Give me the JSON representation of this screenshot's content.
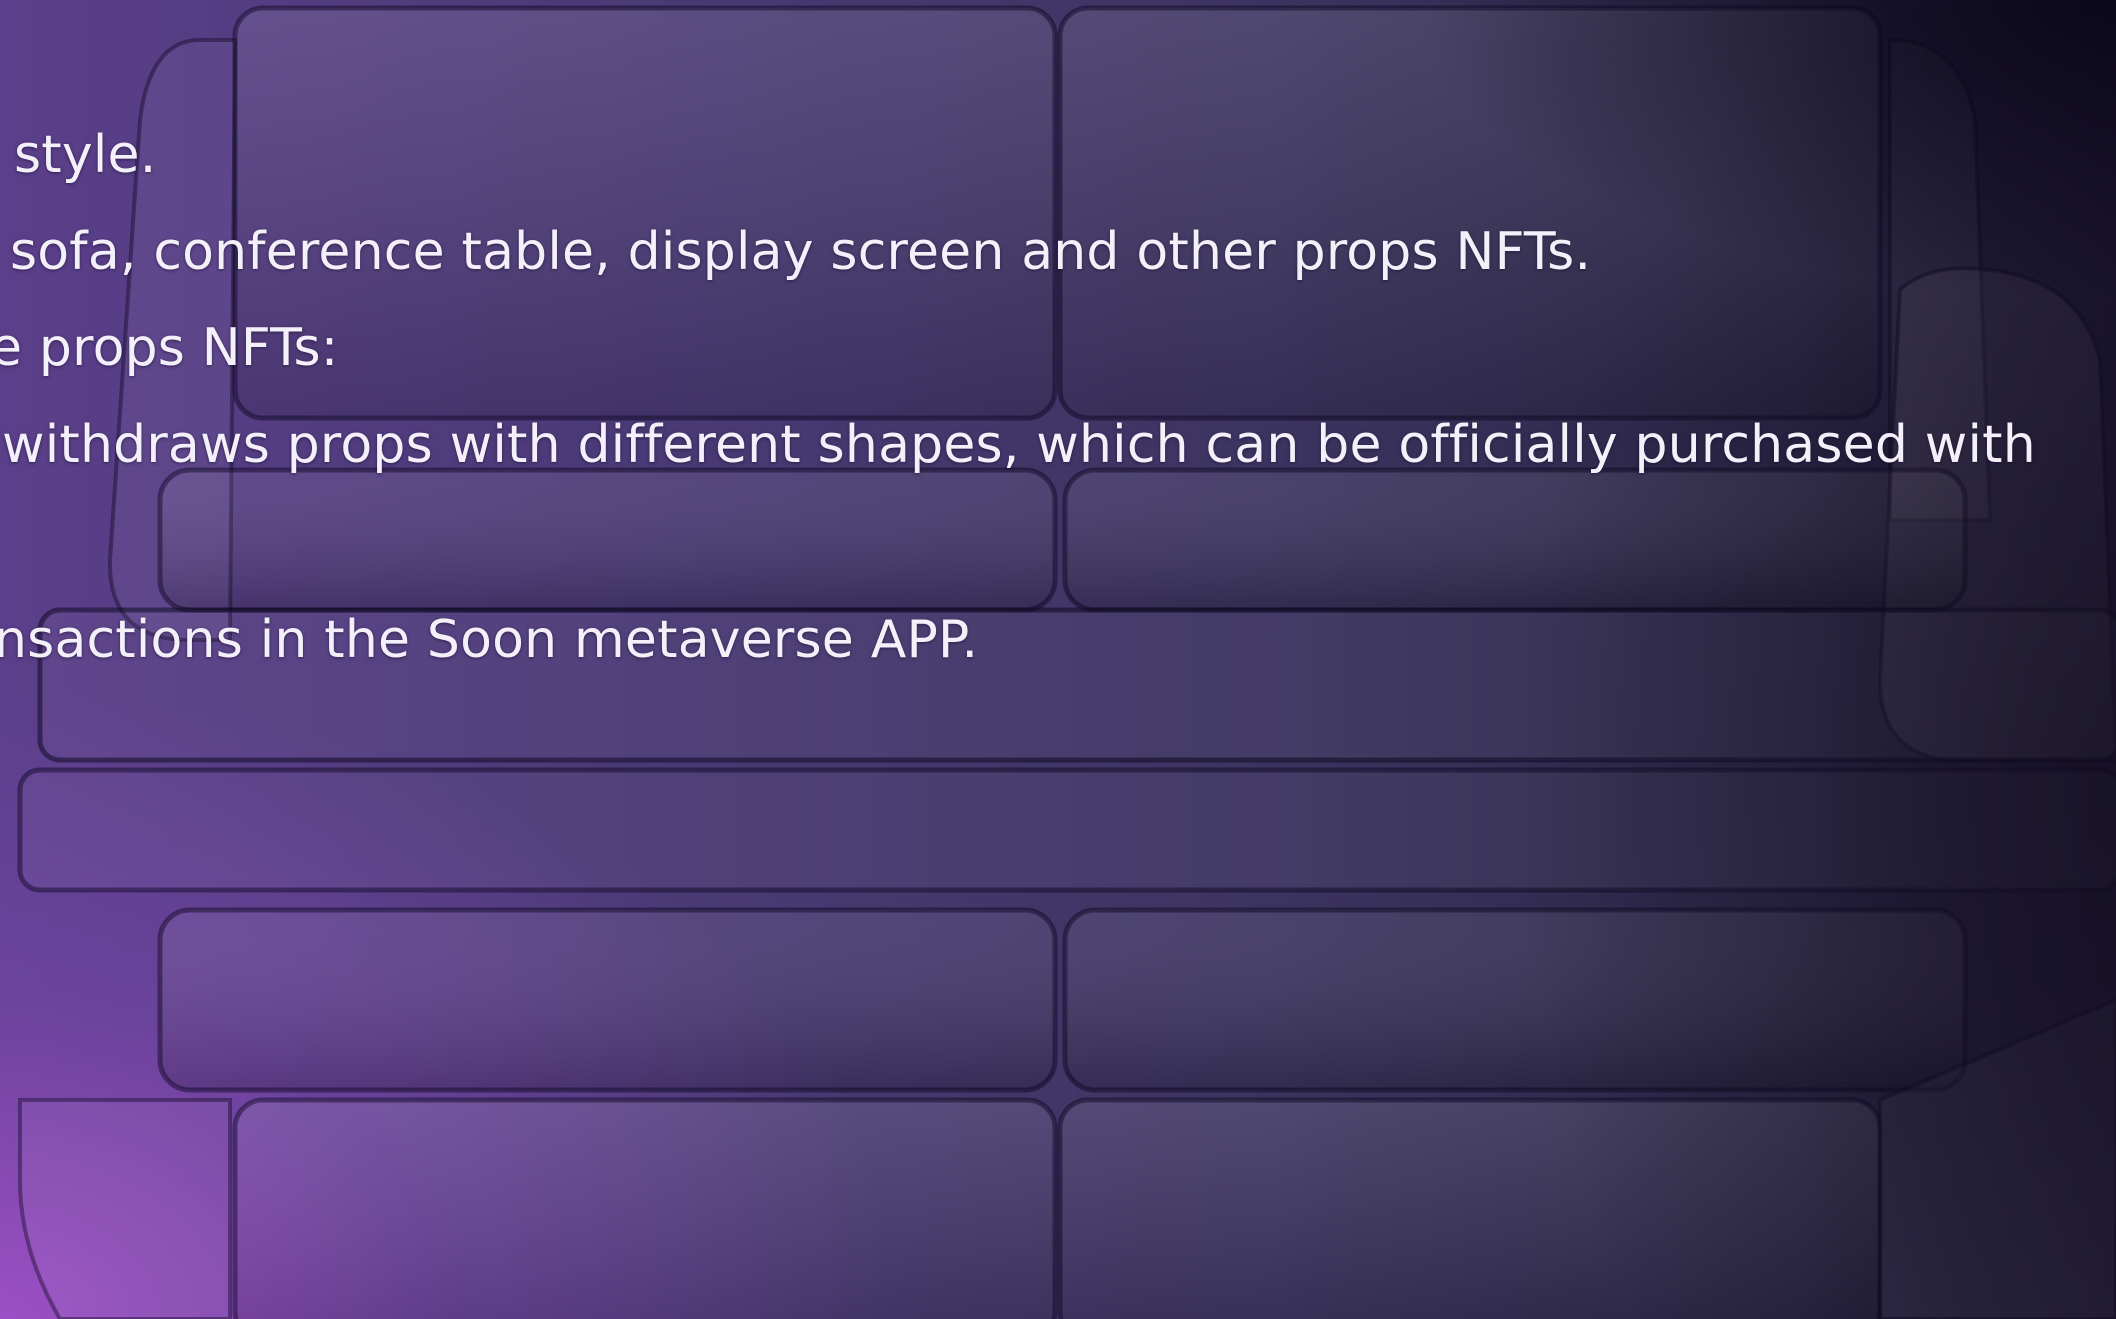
{
  "slide": {
    "lines": [
      "style.",
      "sofa, conference table, display screen and other props NFTs.",
      "e props NFTs:",
      "withdraws props with different shapes, which can be officially purchased with",
      "nsactions in the Soon metaverse APP."
    ]
  },
  "background": {
    "image": "sofa-illustration",
    "colors": {
      "purple_glow": "#a050c8",
      "mid_violet": "#4a3a76",
      "dark_navy": "#1b1530",
      "text": "#f4f0fa"
    }
  }
}
